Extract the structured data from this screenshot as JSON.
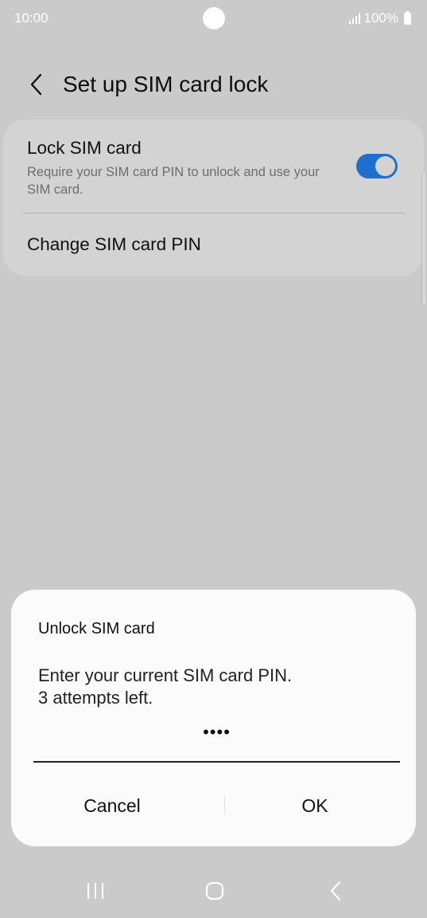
{
  "status_bar": {
    "time": "10:00",
    "battery": "100%"
  },
  "header": {
    "title": "Set up SIM card lock",
    "back_icon": "chevron-left-icon"
  },
  "settings": {
    "lock_sim": {
      "title": "Lock SIM card",
      "description": "Require your SIM card PIN to unlock and use your SIM card.",
      "enabled": true
    },
    "change_pin": {
      "title": "Change SIM card PIN"
    }
  },
  "dialog": {
    "title": "Unlock SIM card",
    "message_line1": "Enter your current SIM card PIN.",
    "message_line2": "3 attempts left.",
    "pin_value": "••••",
    "cancel_label": "Cancel",
    "ok_label": "OK"
  },
  "nav_bar": {
    "recent_icon": "recent-apps-icon",
    "home_icon": "home-icon",
    "back_icon": "back-icon"
  },
  "colors": {
    "accent": "#1e6fce",
    "dimmed_background": "#cacaca",
    "dialog_background": "#fbfbfb"
  }
}
